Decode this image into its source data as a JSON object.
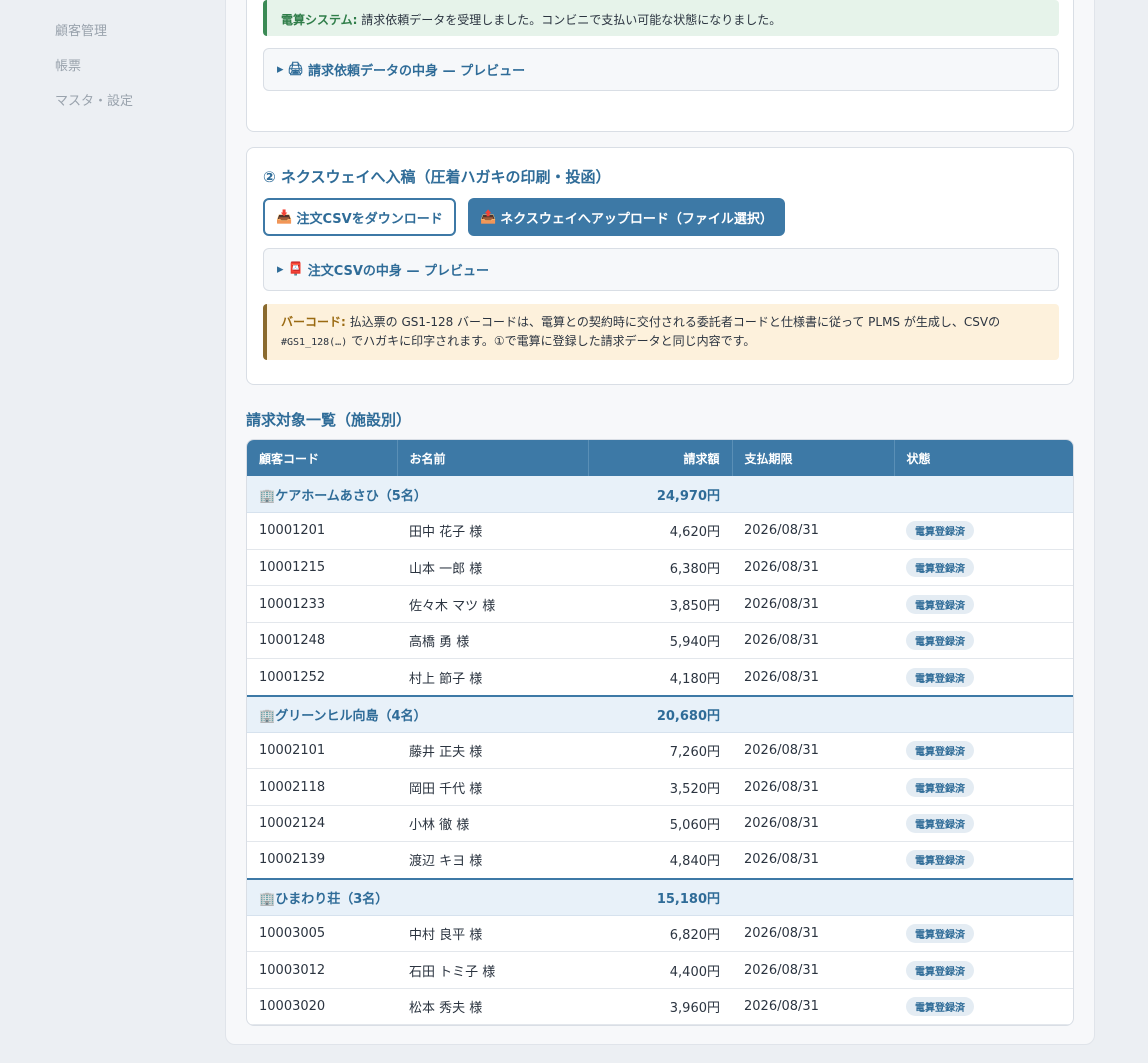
{
  "sidebar": {
    "items": [
      {
        "label": "顧客管理"
      },
      {
        "label": "帳票"
      },
      {
        "label": "マスタ・設定"
      }
    ]
  },
  "step1": {
    "notice_label": "電算システム:",
    "notice_text": "請求依頼データを受理しました。コンビニで支払い可能な状態になりました。",
    "preview_icon": "printer-icon",
    "preview_label": "請求依頼データの中身 — プレビュー"
  },
  "step2": {
    "title": "② ネクスウェイへ入稿（圧着ハガキの印刷・投函）",
    "download_label": "注文CSVをダウンロード",
    "upload_label": "ネクスウェイへアップロード（ファイル選択）",
    "preview_label": "注文CSVの中身 — プレビュー",
    "barcode_label": "バーコード:",
    "barcode_text_1": "払込票の GS1-128 バーコードは、電算との契約時に交付される委託者コードと仕様書に従って PLMS が生成し、CSVの",
    "barcode_code": "#GS1_128(…)",
    "barcode_text_2": "でハガキに印字されます。①で電算に登録した請求データと同じ内容です。"
  },
  "list": {
    "title": "請求対象一覧（施設別）",
    "columns": [
      "顧客コード",
      "お名前",
      "請求額",
      "支払期限",
      "状態"
    ],
    "groups": [
      {
        "name": "ケアホームあさひ（5名）",
        "total": "24,970円",
        "rows": [
          {
            "code": "10001201",
            "name": "田中 花子 様",
            "amount": "4,620円",
            "due": "2026/08/31",
            "status": "電算登録済"
          },
          {
            "code": "10001215",
            "name": "山本 一郎 様",
            "amount": "6,380円",
            "due": "2026/08/31",
            "status": "電算登録済"
          },
          {
            "code": "10001233",
            "name": "佐々木 マツ 様",
            "amount": "3,850円",
            "due": "2026/08/31",
            "status": "電算登録済"
          },
          {
            "code": "10001248",
            "name": "高橋 勇 様",
            "amount": "5,940円",
            "due": "2026/08/31",
            "status": "電算登録済"
          },
          {
            "code": "10001252",
            "name": "村上 節子 様",
            "amount": "4,180円",
            "due": "2026/08/31",
            "status": "電算登録済"
          }
        ]
      },
      {
        "name": "グリーンヒル向島（4名）",
        "total": "20,680円",
        "rows": [
          {
            "code": "10002101",
            "name": "藤井 正夫 様",
            "amount": "7,260円",
            "due": "2026/08/31",
            "status": "電算登録済"
          },
          {
            "code": "10002118",
            "name": "岡田 千代 様",
            "amount": "3,520円",
            "due": "2026/08/31",
            "status": "電算登録済"
          },
          {
            "code": "10002124",
            "name": "小林 徹 様",
            "amount": "5,060円",
            "due": "2026/08/31",
            "status": "電算登録済"
          },
          {
            "code": "10002139",
            "name": "渡辺 キヨ 様",
            "amount": "4,840円",
            "due": "2026/08/31",
            "status": "電算登録済"
          }
        ]
      },
      {
        "name": "ひまわり荘（3名）",
        "total": "15,180円",
        "rows": [
          {
            "code": "10003005",
            "name": "中村 良平 様",
            "amount": "6,820円",
            "due": "2026/08/31",
            "status": "電算登録済"
          },
          {
            "code": "10003012",
            "name": "石田 トミ子 様",
            "amount": "4,400円",
            "due": "2026/08/31",
            "status": "電算登録済"
          },
          {
            "code": "10003020",
            "name": "松本 秀夫 様",
            "amount": "3,960円",
            "due": "2026/08/31",
            "status": "電算登録済"
          }
        ]
      }
    ]
  }
}
